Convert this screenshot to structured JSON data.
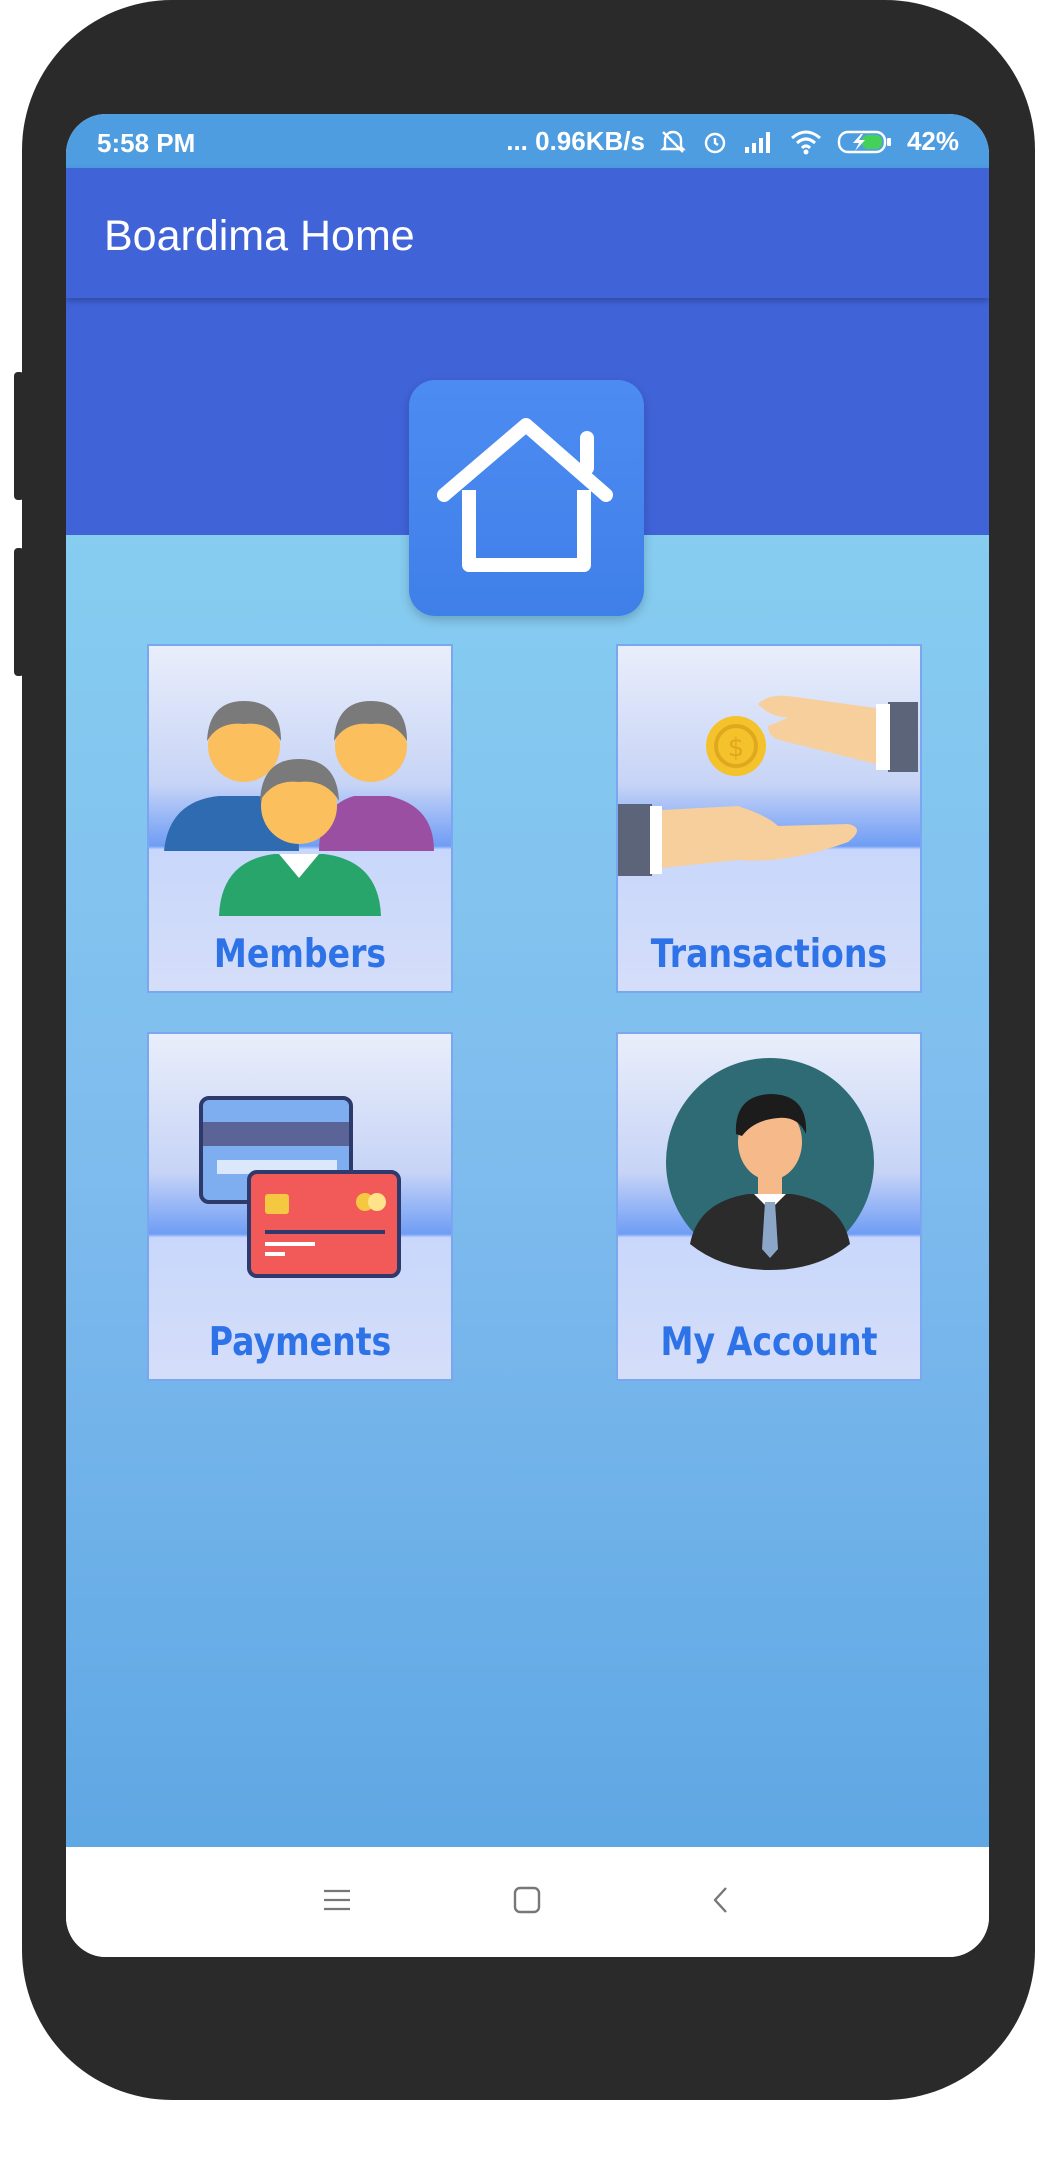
{
  "status_bar": {
    "time": "5:58 PM",
    "network_speed": "... 0.96KB/s",
    "battery_percent": "42%"
  },
  "app_bar": {
    "title": "Boardima Home"
  },
  "header": {
    "icon": "home-icon"
  },
  "menu": {
    "items": [
      {
        "label": "Members",
        "icon": "members-icon"
      },
      {
        "label": "Transactions",
        "icon": "transactions-icon"
      },
      {
        "label": "Payments",
        "icon": "payments-icon"
      },
      {
        "label": "My Account",
        "icon": "my-account-icon"
      }
    ]
  },
  "nav_bar": {
    "buttons": [
      "menu-icon",
      "home-square-icon",
      "back-icon"
    ]
  },
  "colors": {
    "app_bar": "#4063d8",
    "status_bar": "#4e9de0",
    "label": "#2e72e8"
  }
}
